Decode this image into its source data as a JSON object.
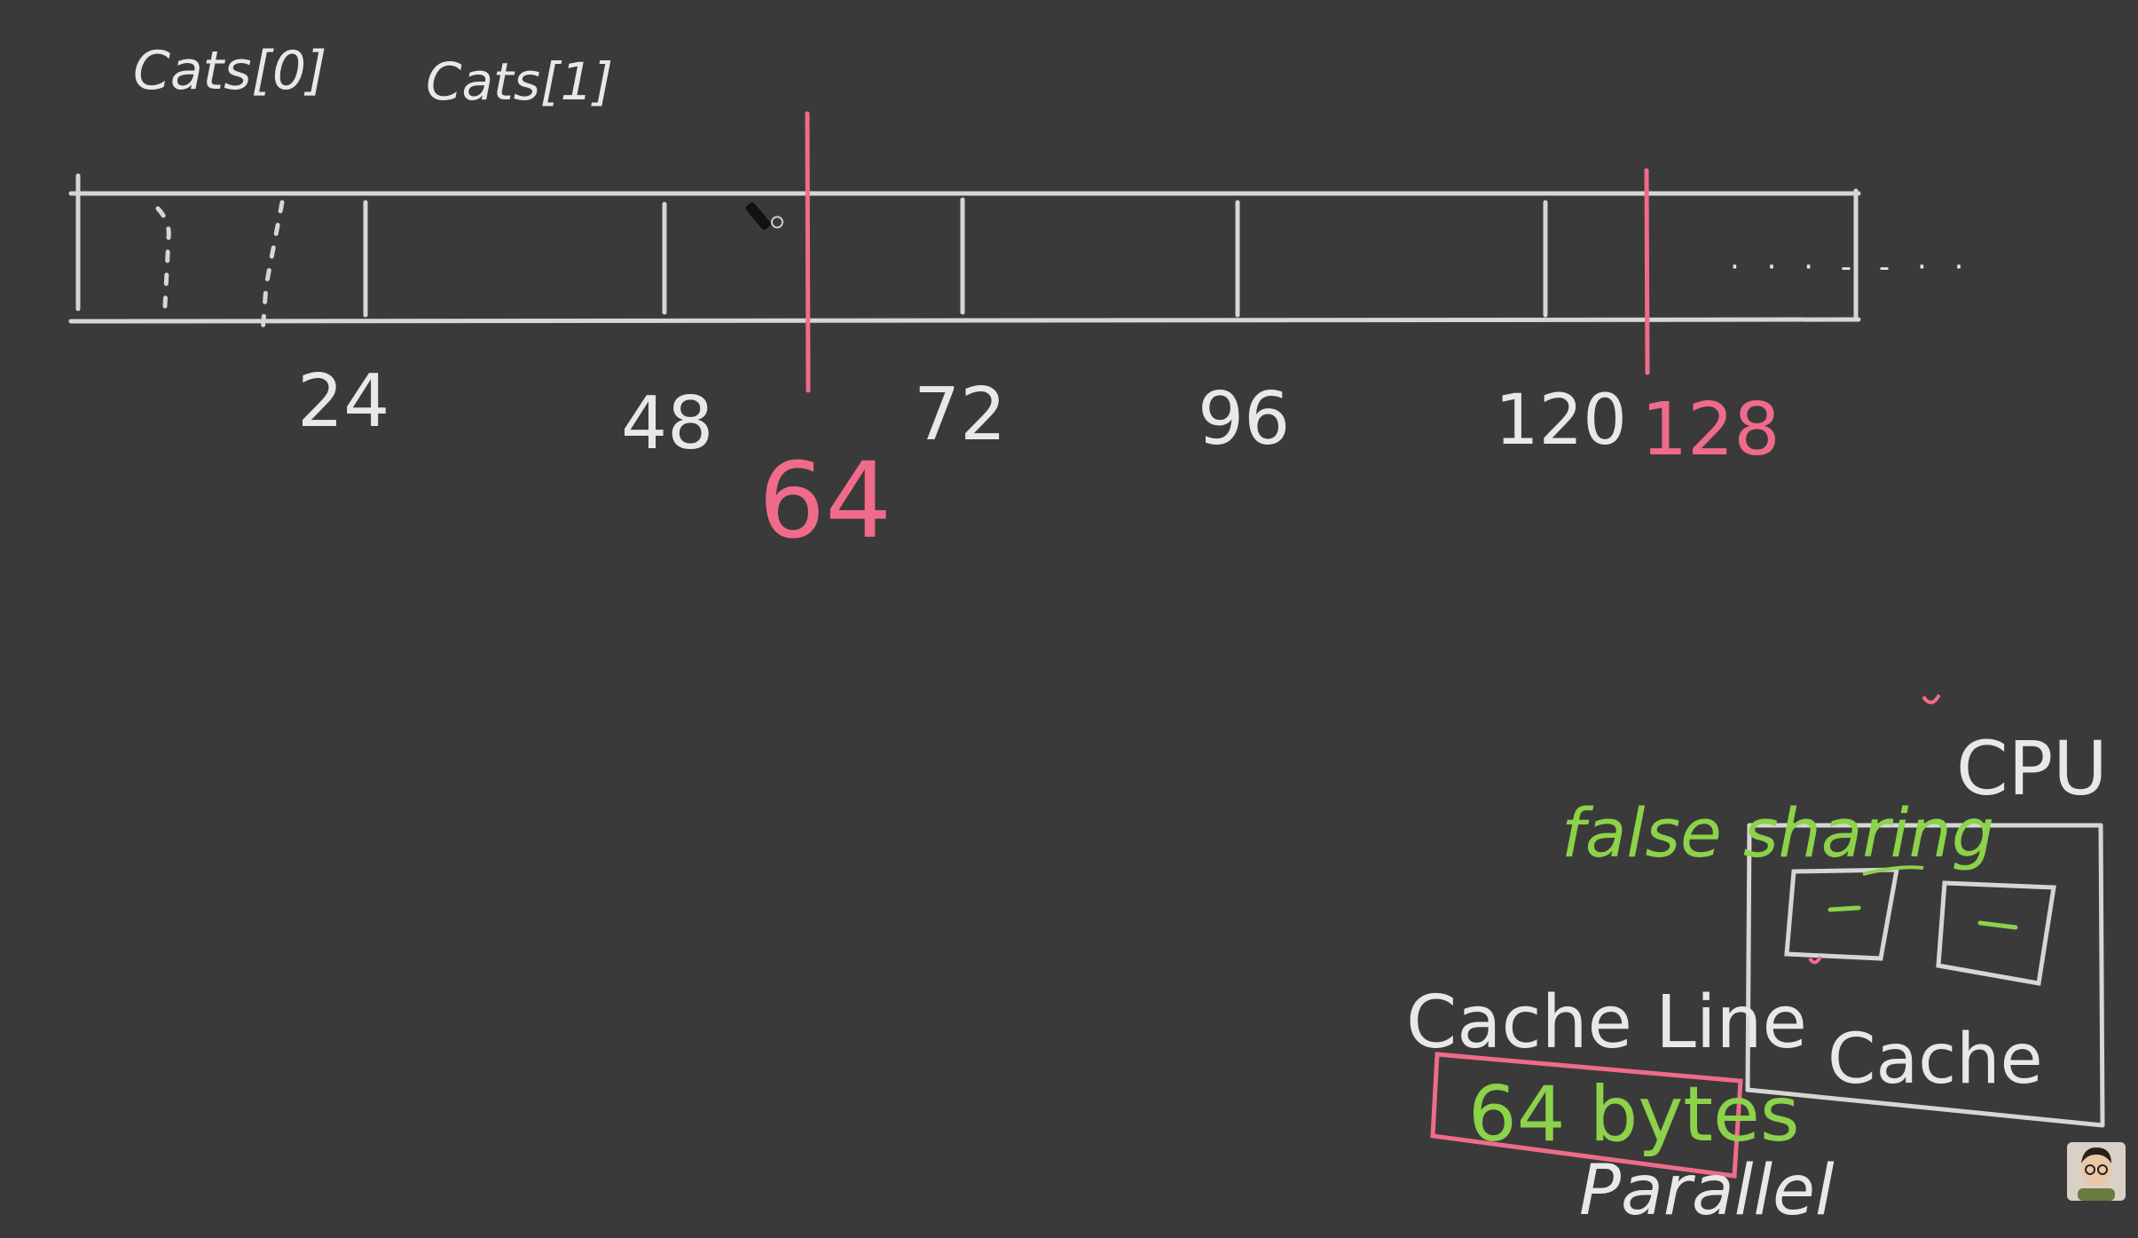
{
  "labels": {
    "cats0": "Cats[0]",
    "cats1": "Cats[1]",
    "cpu": "CPU",
    "cache": "Cache",
    "cache_line": "Cache Line",
    "bytes": "64 bytes",
    "false_sharing": "false sharing",
    "parallel": "Parallel",
    "ellipsis": "· · · - - · ·"
  },
  "offsets": {
    "o24": "24",
    "o48": "48",
    "o72": "72",
    "o96": "96",
    "o120": "120",
    "o128": "128",
    "o64": "64"
  },
  "colors": {
    "chalk": "#e8e8e8",
    "cache_line_boundary": "#f06b8a",
    "highlight": "#8cd24a",
    "background": "#3a3a3a"
  },
  "icons": {
    "cursor": "pen-cursor-icon",
    "presenter": "presenter-avatar"
  }
}
